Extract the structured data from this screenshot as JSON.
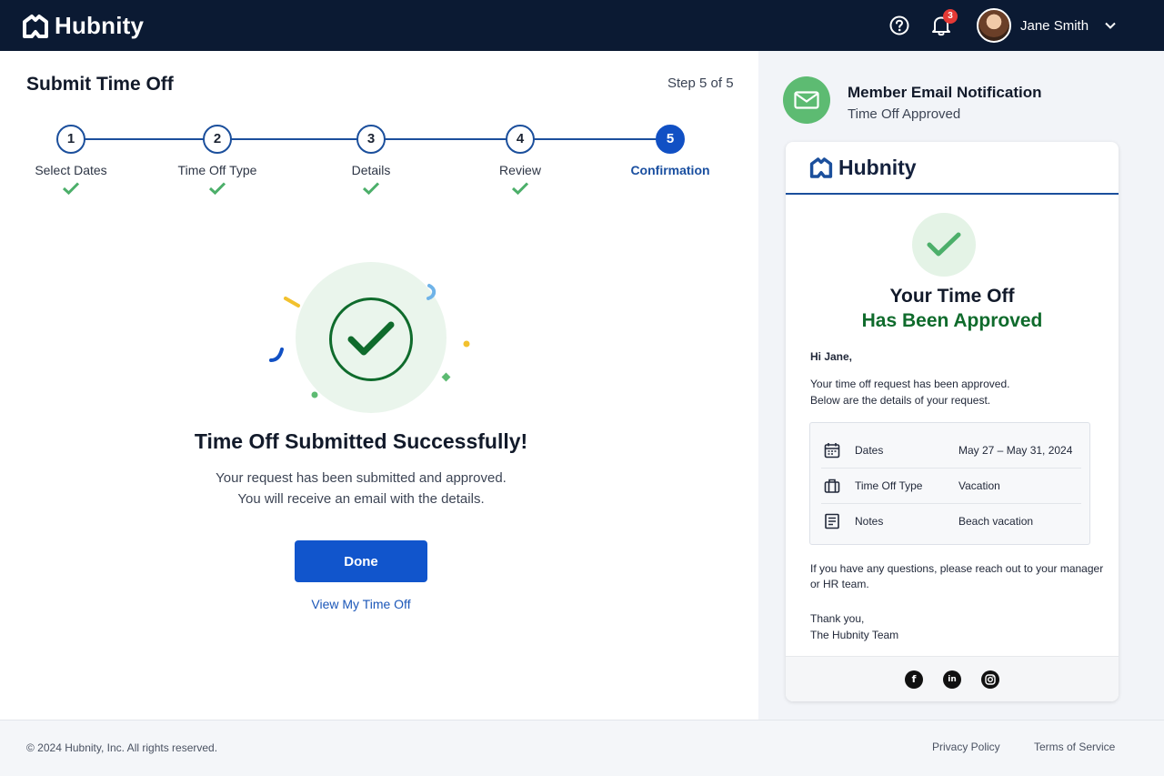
{
  "app": {
    "name": "Hubnity"
  },
  "header": {
    "notifications_count": "3",
    "user_name": "Jane Smith",
    "icons": [
      "help-icon",
      "bell-icon",
      "chevron-down-icon"
    ]
  },
  "main": {
    "title": "Submit Time Off",
    "step_count": "Step 5 of 5",
    "steps": [
      {
        "number": "1",
        "label": "Select Dates",
        "completed": true
      },
      {
        "number": "2",
        "label": "Time Off Type",
        "completed": true
      },
      {
        "number": "3",
        "label": "Details",
        "completed": true
      },
      {
        "number": "4",
        "label": "Review",
        "completed": true
      },
      {
        "number": "5",
        "label": "Confirmation",
        "active": true
      }
    ],
    "success_title": "Time Off Submitted Successfully!",
    "success_line1": "Your request has been submitted and approved.",
    "success_line2": "You will receive an email with the details.",
    "done_label": "Done",
    "view_link": "View My Time Off"
  },
  "side": {
    "notif_title": "Member Email Notification",
    "notif_sub": "Time Off Approved",
    "email": {
      "brand": "Hubnity",
      "heading1": "Your Time Off",
      "heading2": "Has Been Approved",
      "greeting": "Hi Jane,",
      "body1": "Your time off request has been approved.",
      "body2": "Below are the details of your request.",
      "details": [
        {
          "icon": "calendar-icon",
          "label": "Dates",
          "value": "May 27 – May 31, 2024"
        },
        {
          "icon": "suitcase-icon",
          "label": "Time Off Type",
          "value": "Vacation"
        },
        {
          "icon": "notes-icon",
          "label": "Notes",
          "value": "Beach vacation"
        }
      ],
      "questions1": "If you have any questions, please reach out to your manager",
      "questions2": "or HR team.",
      "signoff1": "Thank you,",
      "signoff2": "The Hubnity Team",
      "social": [
        "facebook-icon",
        "linkedin-icon",
        "instagram-icon"
      ]
    }
  },
  "footer": {
    "copyright": "© 2024 Hubnity, Inc. All rights reserved.",
    "privacy": "Privacy Policy",
    "terms": "Terms of Service"
  },
  "colors": {
    "topbar": "#0b1a33",
    "primary": "#1155cc",
    "success": "#0f6b2c",
    "success_light": "#5dbb72"
  }
}
